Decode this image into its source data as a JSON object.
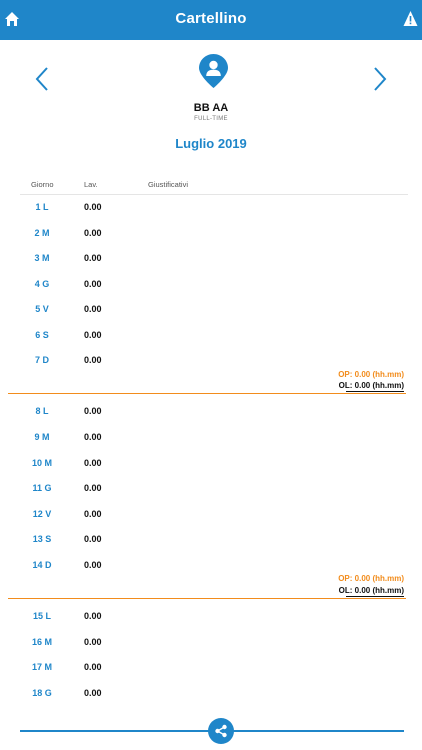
{
  "header": {
    "title": "Cartellino"
  },
  "user": {
    "name": "BB AA",
    "contract": "FULL-TIME"
  },
  "period": {
    "month": "Luglio 2019"
  },
  "columns": {
    "day": "Giorno",
    "hours": "Lav.",
    "justifications": "Giustificativi"
  },
  "weeks": [
    {
      "days": [
        {
          "day": "1 L",
          "hours": "0.00"
        },
        {
          "day": "2 M",
          "hours": "0.00"
        },
        {
          "day": "3 M",
          "hours": "0.00"
        },
        {
          "day": "4 G",
          "hours": "0.00"
        },
        {
          "day": "5 V",
          "hours": "0.00"
        },
        {
          "day": "6 S",
          "hours": "0.00"
        },
        {
          "day": "7 D",
          "hours": "0.00"
        }
      ],
      "op": "OP: 0.00 (hh.mm)",
      "ol": "OL: 0.00 (hh.mm)"
    },
    {
      "days": [
        {
          "day": "8 L",
          "hours": "0.00"
        },
        {
          "day": "9 M",
          "hours": "0.00"
        },
        {
          "day": "10 M",
          "hours": "0.00"
        },
        {
          "day": "11 G",
          "hours": "0.00"
        },
        {
          "day": "12 V",
          "hours": "0.00"
        },
        {
          "day": "13 S",
          "hours": "0.00"
        },
        {
          "day": "14 D",
          "hours": "0.00"
        }
      ],
      "op": "OP: 0.00 (hh.mm)",
      "ol": "OL: 0.00 (hh.mm)"
    },
    {
      "days": [
        {
          "day": "15 L",
          "hours": "0.00"
        },
        {
          "day": "16 M",
          "hours": "0.00"
        },
        {
          "day": "17 M",
          "hours": "0.00"
        },
        {
          "day": "18 G",
          "hours": "0.00"
        }
      ]
    }
  ],
  "icons": {
    "home": "home-icon",
    "warning": "warning-icon",
    "prev": "chevron-left-icon",
    "next": "chevron-right-icon",
    "avatar": "user-avatar-icon",
    "share": "share-icon"
  },
  "colors": {
    "accent": "#1f86c9",
    "highlight": "#f28c1c"
  }
}
